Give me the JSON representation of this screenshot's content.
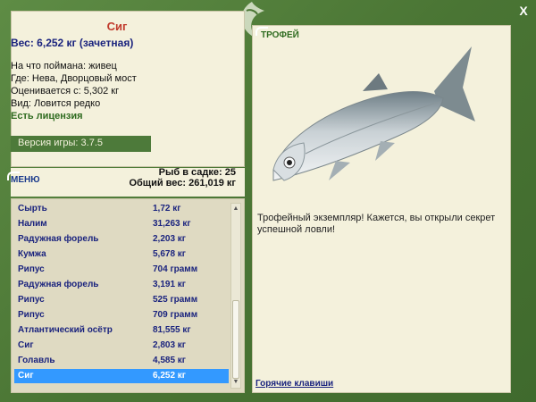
{
  "close_label": "X",
  "fish": {
    "name": "Сиг",
    "weight_line": "Вес: 6,252 кг (зачетная)",
    "bait": "На что поймана: живец",
    "place": "Где: Нева, Дворцовый мост",
    "price": "Оценивается с: 5,302 кг",
    "rarity": "Вид: Ловится редко"
  },
  "license": "Есть лицензия",
  "version": "Версия игры: 3.7.5",
  "menu_label": "МЕНЮ",
  "stats": {
    "count": "Рыб в садке: 25",
    "total": "Общий вес: 261,019 кг"
  },
  "catches": [
    {
      "name": "Сырть",
      "weight": "1,72 кг"
    },
    {
      "name": "Налим",
      "weight": "31,263 кг"
    },
    {
      "name": "Радужная форель",
      "weight": "2,203 кг"
    },
    {
      "name": "Кумжа",
      "weight": "5,678 кг"
    },
    {
      "name": "Рипус",
      "weight": "704 грамм"
    },
    {
      "name": "Радужная форель",
      "weight": "3,191 кг"
    },
    {
      "name": "Рипус",
      "weight": "525 грамм"
    },
    {
      "name": "Рипус",
      "weight": "709 грамм"
    },
    {
      "name": "Атлантический осётр",
      "weight": "81,555 кг"
    },
    {
      "name": "Сиг",
      "weight": "2,803 кг"
    },
    {
      "name": "Голавль",
      "weight": "4,585 кг"
    },
    {
      "name": "Сиг",
      "weight": "6,252 кг"
    }
  ],
  "selected_index": 11,
  "trophy": {
    "label": "ТРОФЕЙ",
    "text": "Трофейный экземпляр! Кажется, вы открыли секрет успешной ловли!"
  },
  "hotkeys": "Горячие клавиши",
  "colors": {
    "frame": "#4f7a3a",
    "panel": "#f4f1dc",
    "list_bg": "#dfdac2",
    "selected": "#3399ff",
    "fish_name": "#c0392b",
    "text_blue": "#1a237e"
  }
}
